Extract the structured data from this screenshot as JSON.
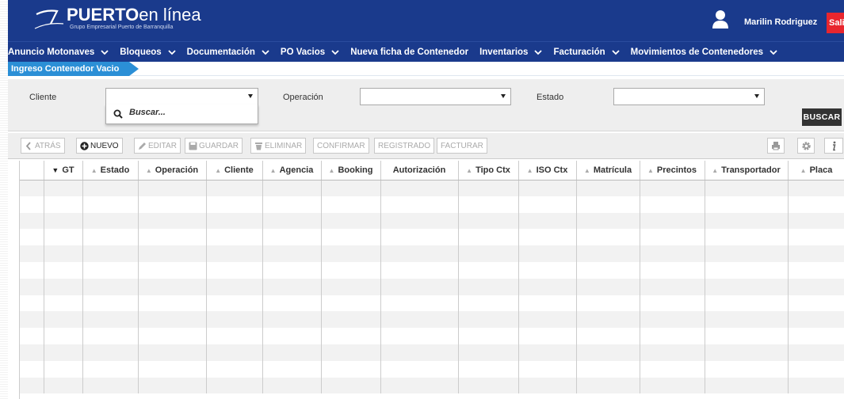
{
  "header": {
    "brand_bold": "PUERTO",
    "brand_light": "en línea",
    "brand_sub": "Grupo Empresarial Puerto de Barranquilla",
    "user_name": "Marilin Rodriguez",
    "exit_label": "Salir"
  },
  "colors": {
    "header_bg": "#1a3a8c",
    "crumb_bg": "#2b8fd6",
    "exit_bg": "#e8262e"
  },
  "nav": [
    {
      "label": "Anuncio Motonaves",
      "has_menu": true
    },
    {
      "label": "Bloqueos",
      "has_menu": true
    },
    {
      "label": "Documentación",
      "has_menu": true
    },
    {
      "label": "PO Vacios",
      "has_menu": true
    },
    {
      "label": "Nueva ficha de Contenedor",
      "has_menu": false
    },
    {
      "label": "Inventarios",
      "has_menu": true
    },
    {
      "label": "Facturación",
      "has_menu": true
    },
    {
      "label": "Movimientos de Contenedores",
      "has_menu": true
    }
  ],
  "breadcrumb": {
    "label": "Ingreso Contenedor Vacio"
  },
  "filters": {
    "cliente_label": "Cliente",
    "cliente_value": "",
    "operacion_label": "Operación",
    "operacion_value": "",
    "estado_label": "Estado",
    "estado_value": "",
    "search_placeholder": "Buscar...",
    "buscar_label": "BUSCAR"
  },
  "toolbar": {
    "atras": "ATRÁS",
    "nuevo": "NUEVO",
    "editar": "EDITAR",
    "guardar": "GUARDAR",
    "eliminar": "ELIMINAR",
    "confirmar": "CONFIRMAR",
    "registrado": "REGISTRADO",
    "facturar": "FACTURAR",
    "right_icons": [
      "print-icon",
      "gear-icon",
      "info-icon"
    ]
  },
  "table": {
    "columns": [
      "",
      "GT",
      "Estado",
      "Operación",
      "Cliente",
      "Agencia",
      "Booking",
      "Autorización",
      "Tipo Ctx",
      "ISO Ctx",
      "Matrícula",
      "Precintos",
      "Transportador",
      "Placa"
    ],
    "sort_active": "GT",
    "rows": []
  }
}
